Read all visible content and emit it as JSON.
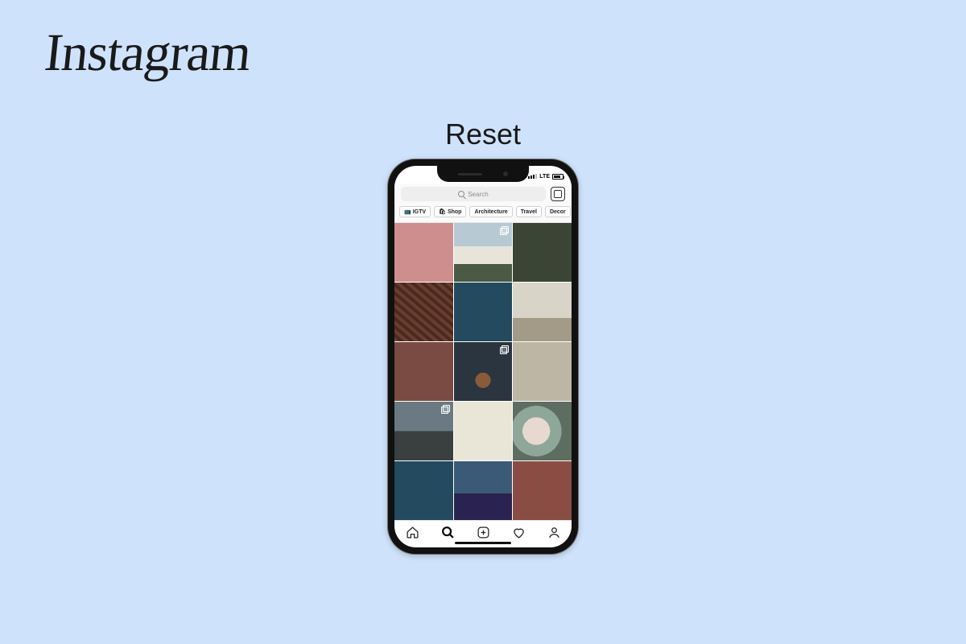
{
  "logo_text": "Instagram",
  "heading": "Reset",
  "status": {
    "carrier": "LTE"
  },
  "search": {
    "placeholder": "Search"
  },
  "chips": [
    {
      "icon": "tv",
      "label": "IGTV"
    },
    {
      "icon": "bag",
      "label": "Shop"
    },
    {
      "icon": "",
      "label": "Architecture"
    },
    {
      "icon": "",
      "label": "Travel"
    },
    {
      "icon": "",
      "label": "Decor"
    }
  ],
  "grid": {
    "tiles": [
      {
        "tone": "t0",
        "carousel": false
      },
      {
        "tone": "t1",
        "carousel": true
      },
      {
        "tone": "t2",
        "carousel": false
      },
      {
        "tone": "t3",
        "carousel": false
      },
      {
        "tone": "t4",
        "carousel": false
      },
      {
        "tone": "t5",
        "carousel": false
      },
      {
        "tone": "t6",
        "carousel": false
      },
      {
        "tone": "t7",
        "carousel": true
      },
      {
        "tone": "t8",
        "carousel": false
      },
      {
        "tone": "t9",
        "carousel": true
      },
      {
        "tone": "t10",
        "carousel": false
      },
      {
        "tone": "t11",
        "carousel": false
      },
      {
        "tone": "t12",
        "carousel": false
      },
      {
        "tone": "t13",
        "carousel": false
      },
      {
        "tone": "t14",
        "carousel": false
      }
    ]
  },
  "tabs": {
    "home": "home",
    "search": "search",
    "add": "add",
    "activity": "activity",
    "profile": "profile",
    "active": "search"
  }
}
